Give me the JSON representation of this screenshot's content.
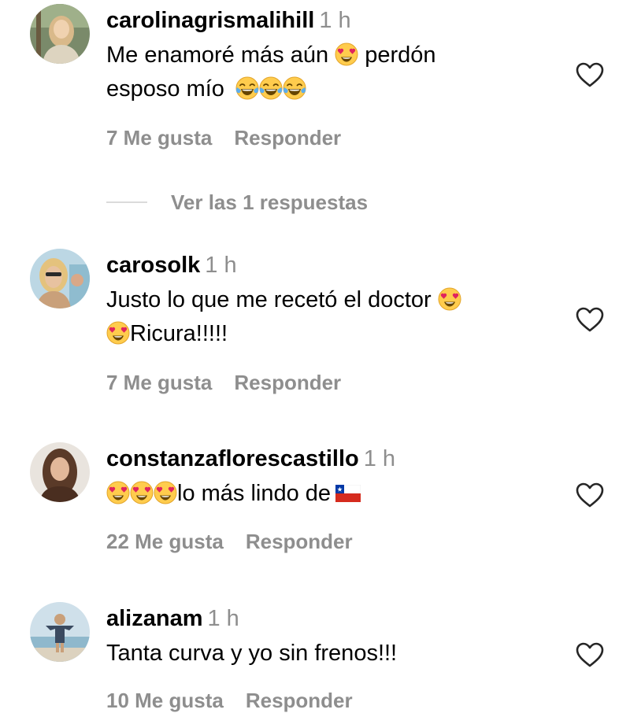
{
  "comments": [
    {
      "username": "carolinagrismalihill",
      "time": "1 h",
      "text_line1_a": "Me enamoré más aún",
      "text_line1_b": "perdón",
      "text_line2": "esposo mío",
      "likes": "7 Me gusta",
      "reply": "Responder",
      "view_replies": "Ver las 1 respuestas"
    },
    {
      "username": "carosolk",
      "time": "1 h",
      "text_line1": "Justo lo que me recetó el doctor",
      "text_line2": "Ricura!!!!!",
      "likes": "7 Me gusta",
      "reply": "Responder"
    },
    {
      "username": "constanzaflorescastillo",
      "time": "1 h",
      "text_line1": "lo más lindo de",
      "likes": "22 Me gusta",
      "reply": "Responder"
    },
    {
      "username": "alizanam",
      "time": "1 h",
      "text_line1": "Tanta curva y yo sin frenos!!!",
      "likes": "10 Me gusta",
      "reply": "Responder"
    }
  ],
  "icons": {
    "like": "heart-outline-icon",
    "heart_eyes": "heart-eyes-emoji",
    "laughing": "tears-of-joy-emoji",
    "flag": "chile-flag-emoji"
  },
  "colors": {
    "text": "#000000",
    "secondary": "#8e8e8e",
    "divider": "#dbdbdb"
  }
}
